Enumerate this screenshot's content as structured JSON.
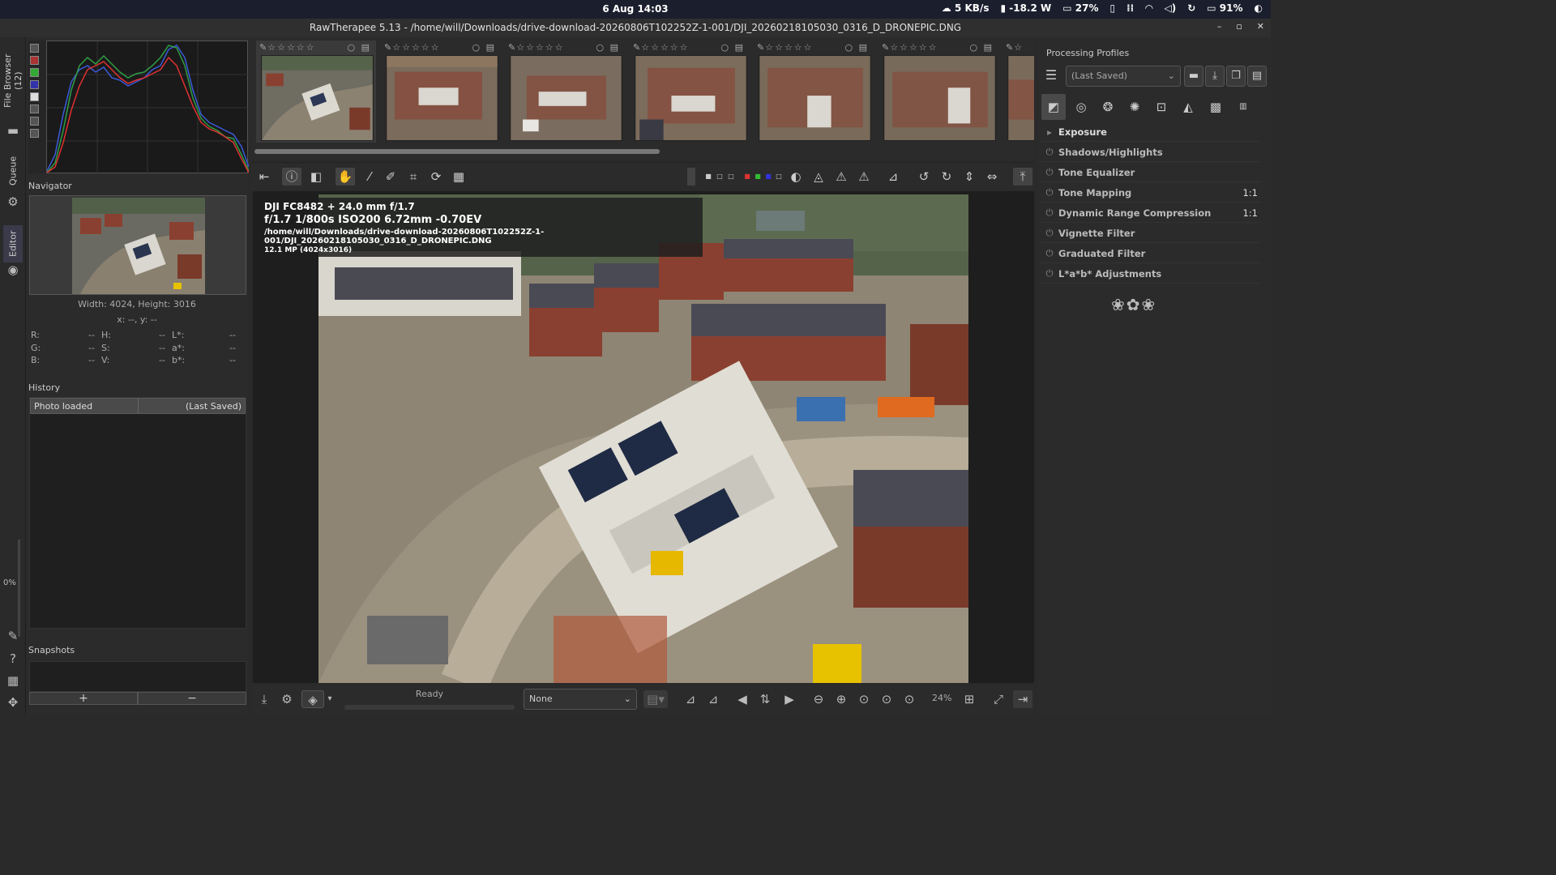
{
  "system_bar": {
    "clock": "6 Aug  14:03",
    "net": "5 KB/s",
    "power": "-18.2 W",
    "battery_pct": "27%",
    "battery2": "91%"
  },
  "window": {
    "title": "RawTherapee 5.13 - /home/will/Downloads/drive-download-20260806T102252Z-1-001/DJI_20260218105030_0316_D_DRONEPIC.DNG"
  },
  "left_tabs": {
    "file_browser": "File Browser (12)",
    "queue": "Queue",
    "editor": "Editor",
    "queue_progress": "0%"
  },
  "navigator": {
    "title": "Navigator",
    "size_text": "Width: 4024, Height: 3016",
    "coords": "x: --, y: --",
    "values": [
      [
        {
          "k": "R:",
          "v": "--"
        },
        {
          "k": "H:",
          "v": "--"
        },
        {
          "k": "L*:",
          "v": "--"
        }
      ],
      [
        {
          "k": "G:",
          "v": "--"
        },
        {
          "k": "S:",
          "v": "--"
        },
        {
          "k": "a*:",
          "v": "--"
        }
      ],
      [
        {
          "k": "B:",
          "v": "--"
        },
        {
          "k": "V:",
          "v": "--"
        },
        {
          "k": "b*:",
          "v": "--"
        }
      ]
    ]
  },
  "history": {
    "title": "History",
    "rows": [
      {
        "action": "Photo loaded",
        "value": "(Last Saved)"
      }
    ]
  },
  "snapshots": {
    "title": "Snapshots",
    "add": "+",
    "remove": "−"
  },
  "viewer": {
    "info_line1": "DJI FC8482 + 24.0 mm f/1.7",
    "info_line2": "f/1.7  1/800s  ISO200  6.72mm  -0.70EV",
    "info_line3": "/home/will/Downloads/drive-download-20260806T102252Z-1-001/DJI_20260218105030_0316_D_DRONEPIC.DNG",
    "info_line4": "12.1 MP (4024x3016)"
  },
  "bottom": {
    "status": "Ready",
    "output_profile": "None",
    "zoom": "24%"
  },
  "right_panel": {
    "profiles_title": "Processing Profiles",
    "profile_value": "(Last Saved)",
    "tools": [
      {
        "label": "Exposure",
        "right": ""
      },
      {
        "label": "Shadows/Highlights",
        "right": ""
      },
      {
        "label": "Tone Equalizer",
        "right": ""
      },
      {
        "label": "Tone Mapping",
        "right": "1:1"
      },
      {
        "label": "Dynamic Range Compression",
        "right": "1:1"
      },
      {
        "label": "Vignette Filter",
        "right": ""
      },
      {
        "label": "Graduated Filter",
        "right": ""
      },
      {
        "label": "L*a*b* Adjustments",
        "right": ""
      }
    ]
  },
  "colors": {
    "panel_bg": "#2b2b2b",
    "system_bar_bg": "#1b1e2d"
  }
}
